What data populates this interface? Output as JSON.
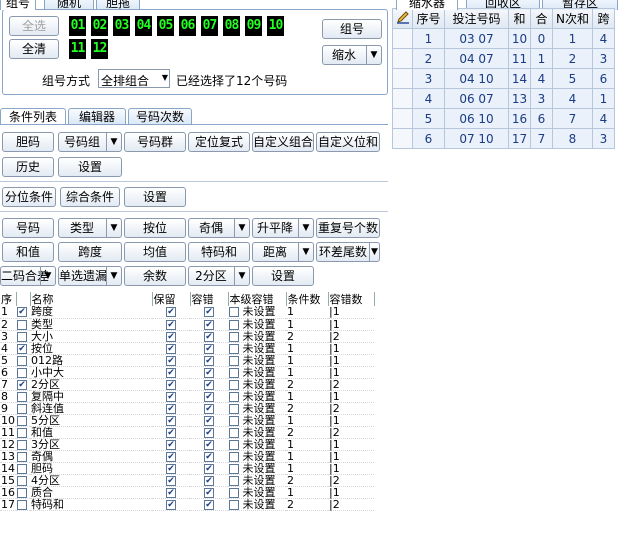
{
  "top_tabs": [
    "组号",
    "随机",
    "胆拖"
  ],
  "left_buttons": {
    "select_all": "全选",
    "clear_all": "全清"
  },
  "led_numbers": [
    "01",
    "02",
    "03",
    "04",
    "05",
    "06",
    "07",
    "08",
    "09",
    "10",
    "11",
    "12"
  ],
  "right_buttons": {
    "group": "组号",
    "shrink": "缩水"
  },
  "group_method_label": "组号方式",
  "group_method_value": "全排组合",
  "status_text": "已经选择了12个号码",
  "condition_tabs": [
    "条件列表",
    "编辑器",
    "号码次数"
  ],
  "row1": [
    "胆码",
    "号码组",
    "号码群",
    "定位复式",
    "自定义组合",
    "自定义位和"
  ],
  "row2": [
    "历史",
    "设置"
  ],
  "row3": [
    "分位条件",
    "综合条件",
    "设置"
  ],
  "row4": [
    "号码",
    "类型",
    "按位",
    "奇偶",
    "升平降",
    "重复号个数"
  ],
  "row5": [
    "和值",
    "跨度",
    "均值",
    "特码和",
    "距离",
    "环差尾数"
  ],
  "row6": [
    "二码合差",
    "单选遗漏",
    "余数",
    "2分区",
    "设置"
  ],
  "grid_headers": [
    "序",
    "名称",
    "保留",
    "容错",
    "本级容错",
    "条件数",
    "容错数"
  ],
  "grid_rows": [
    {
      "n": "1",
      "c": true,
      "name": "跨度",
      "a": "1",
      "b": "1"
    },
    {
      "n": "2",
      "c": false,
      "name": "类型",
      "a": "1",
      "b": "1"
    },
    {
      "n": "3",
      "c": false,
      "name": "大小",
      "a": "2",
      "b": "2"
    },
    {
      "n": "4",
      "c": true,
      "name": "按位",
      "a": "1",
      "b": "1"
    },
    {
      "n": "5",
      "c": false,
      "name": "012路",
      "a": "1",
      "b": "1"
    },
    {
      "n": "6",
      "c": false,
      "name": "小中大",
      "a": "1",
      "b": "1"
    },
    {
      "n": "7",
      "c": true,
      "name": "2分区",
      "a": "2",
      "b": "2"
    },
    {
      "n": "8",
      "c": false,
      "name": "复隔中",
      "a": "1",
      "b": "1"
    },
    {
      "n": "9",
      "c": false,
      "name": "斜连值",
      "a": "2",
      "b": "2"
    },
    {
      "n": "10",
      "c": false,
      "name": "5分区",
      "a": "1",
      "b": "1"
    },
    {
      "n": "11",
      "c": false,
      "name": "和值",
      "a": "2",
      "b": "2"
    },
    {
      "n": "12",
      "c": false,
      "name": "3分区",
      "a": "1",
      "b": "1"
    },
    {
      "n": "13",
      "c": false,
      "name": "奇偶",
      "a": "1",
      "b": "1"
    },
    {
      "n": "14",
      "c": false,
      "name": "胆码",
      "a": "1",
      "b": "1"
    },
    {
      "n": "15",
      "c": false,
      "name": "4分区",
      "a": "2",
      "b": "2"
    },
    {
      "n": "16",
      "c": false,
      "name": "质合",
      "a": "1",
      "b": "1"
    },
    {
      "n": "17",
      "c": false,
      "name": "特码和",
      "a": "2",
      "b": "2"
    }
  ],
  "grid_unset_text": "未设置",
  "right_tabs": [
    "缩水器",
    "回收区",
    "暂存区"
  ],
  "result_headers": [
    "序号",
    "投注号码",
    "和",
    "合",
    "N次和",
    "跨"
  ],
  "result_rows": [
    [
      "1",
      "03 07",
      "10",
      "0",
      "1",
      "4"
    ],
    [
      "2",
      "04 07",
      "11",
      "1",
      "2",
      "3"
    ],
    [
      "3",
      "04 10",
      "14",
      "4",
      "5",
      "6"
    ],
    [
      "4",
      "06 07",
      "13",
      "3",
      "4",
      "1"
    ],
    [
      "5",
      "06 10",
      "16",
      "6",
      "7",
      "4"
    ],
    [
      "6",
      "07 10",
      "17",
      "7",
      "8",
      "3"
    ]
  ]
}
